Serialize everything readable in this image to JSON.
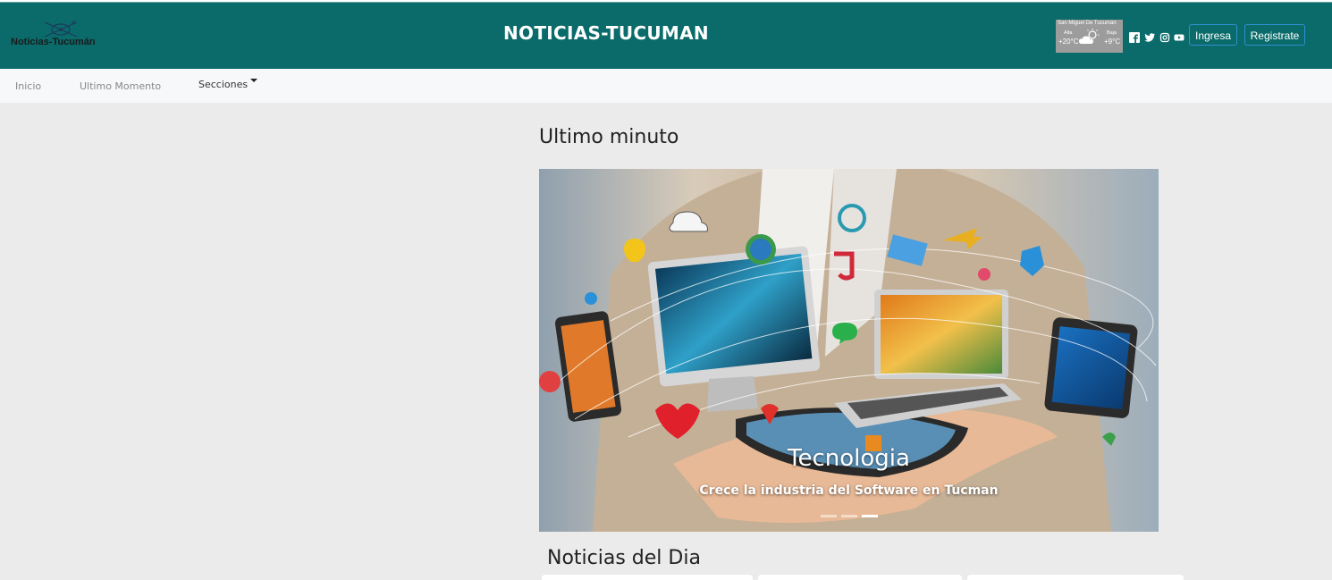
{
  "header": {
    "logo_text": "Noticias-Tucumán",
    "site_title": "NOTICIAS-TUCUMAN",
    "weather": {
      "city": "San Miguel De Tucumán",
      "high_label": "Alta",
      "high_value": "+20°C",
      "low_label": "Baja",
      "low_value": "+9°C",
      "icon": "partly-cloudy-icon"
    },
    "social_icons": [
      "facebook-icon",
      "twitter-icon",
      "instagram-icon",
      "youtube-icon"
    ],
    "login_label": "Ingresa",
    "register_label": "Registrate",
    "colors": {
      "header_bg": "#0b6b6b",
      "button_border": "#2f8fd0"
    }
  },
  "nav": {
    "items": [
      {
        "label": "Inicio"
      },
      {
        "label": "Ultimo Momento"
      },
      {
        "label": "Secciones"
      }
    ]
  },
  "main": {
    "latest_title": "Ultimo minuto",
    "carousel": {
      "slide_title": "Tecnologia",
      "slide_subtitle": "Crece la industria del Software en Tucman",
      "indicator_count": 3,
      "active_index": 2
    },
    "news_title": "Noticias del Dia"
  }
}
